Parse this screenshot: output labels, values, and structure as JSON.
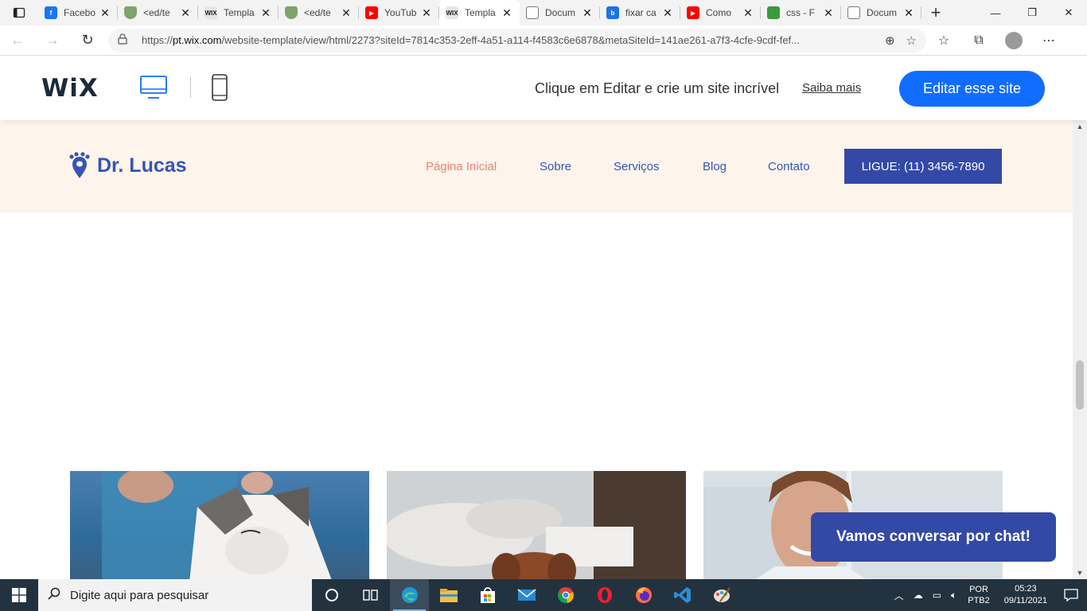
{
  "browser": {
    "tabs": [
      {
        "title": "Facebo",
        "icon": "facebook-icon",
        "color": "#1877f2",
        "glyph": "f",
        "width": 100
      },
      {
        "title": "<ed/te",
        "icon": "shield-icon",
        "color": "#7fa36b",
        "glyph": "",
        "width": 101
      },
      {
        "title": "Templa",
        "icon": "wix-icon",
        "color": "#e6e6e6",
        "glyph": "WIX",
        "width": 101
      },
      {
        "title": "<ed/te",
        "icon": "shield-icon",
        "color": "#7fa36b",
        "glyph": "",
        "width": 101
      },
      {
        "title": "YouTub",
        "icon": "youtube-icon",
        "color": "#ff0000",
        "glyph": "▶",
        "width": 101
      },
      {
        "title": "Templa",
        "icon": "wix-icon",
        "color": "#e6e6e6",
        "glyph": "WIX",
        "width": 101,
        "active": true
      },
      {
        "title": "Docum",
        "icon": "document-icon",
        "color": "#ffffff",
        "glyph": "",
        "width": 101
      },
      {
        "title": "fixar ca",
        "icon": "bing-icon",
        "color": "#1a73e8",
        "glyph": "b",
        "width": 101
      },
      {
        "title": "Como",
        "icon": "youtube-icon",
        "color": "#ff0000",
        "glyph": "▶",
        "width": 101
      },
      {
        "title": "css - F",
        "icon": "stackoverflow-icon",
        "color": "#3a9a3a",
        "glyph": "",
        "width": 101
      },
      {
        "title": "Docum",
        "icon": "document-icon",
        "color": "#ffffff",
        "glyph": "",
        "width": 101
      }
    ],
    "url_prefix": "https://",
    "url_domain": "pt.wix.com",
    "url_rest": "/website-template/view/html/2273?siteId=7814c353-2eff-4a51-a114-f4583c6e6878&metaSiteId=141ae261-a7f3-4cfe-9cdf-fef..."
  },
  "wix": {
    "logo": "WiX",
    "tagline": "Clique em Editar e crie um site incrível",
    "learn_more": "Saiba mais",
    "edit_button": "Editar esse site",
    "accent": "#116dff"
  },
  "site": {
    "logo": "Dr. Lucas",
    "nav": [
      {
        "label": "Página Inicial",
        "active": true
      },
      {
        "label": "Sobre"
      },
      {
        "label": "Serviços"
      },
      {
        "label": "Blog"
      },
      {
        "label": "Contato"
      }
    ],
    "call_button": "LIGUE: (11) 3456-7890",
    "chat_button": "Vamos conversar por chat!",
    "brand_color": "#3349a6",
    "active_color": "#e8866e",
    "header_bg": "#fdf4ec"
  },
  "taskbar": {
    "search_placeholder": "Digite aqui para pesquisar",
    "apps": [
      "cortana-icon",
      "task-view-icon",
      "edge-icon",
      "file-explorer-icon",
      "store-icon",
      "mail-icon",
      "chrome-icon",
      "opera-icon",
      "firefox-icon",
      "vscode-icon",
      "paint-icon"
    ],
    "lang_top": "POR",
    "lang_bottom": "PTB2",
    "time": "05:23",
    "date": "09/11/2021"
  }
}
